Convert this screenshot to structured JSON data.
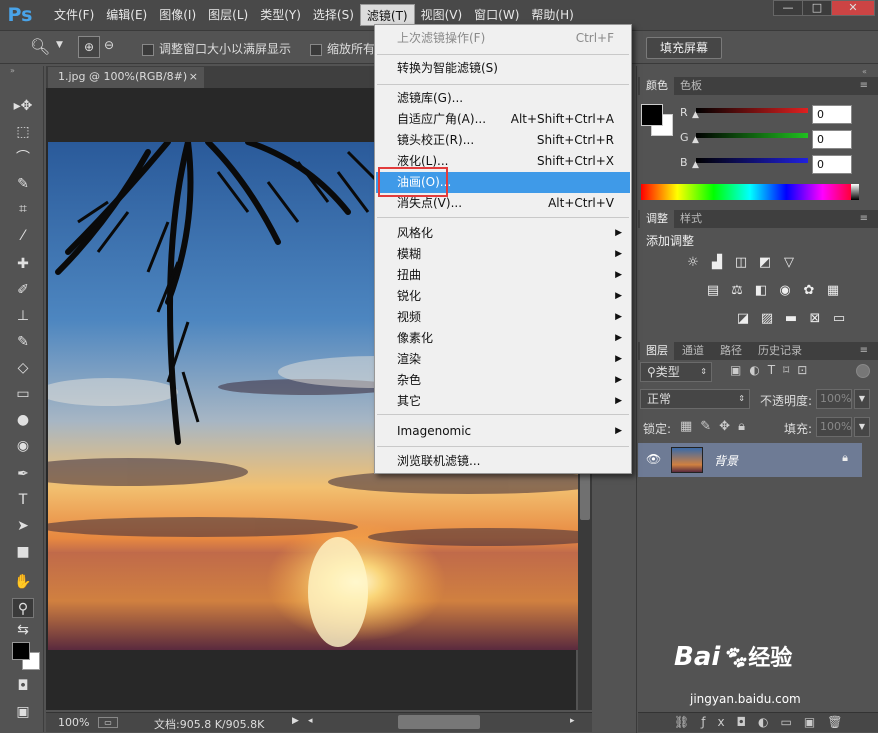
{
  "app": {
    "logo": "Ps"
  },
  "menubar": {
    "items": [
      "文件(F)",
      "编辑(E)",
      "图像(I)",
      "图层(L)",
      "类型(Y)",
      "选择(S)",
      "滤镜(T)",
      "视图(V)",
      "窗口(W)",
      "帮助(H)"
    ],
    "active": "滤镜(T)"
  },
  "window_controls": {
    "minimize": "—",
    "maximize": "□",
    "close": "✕"
  },
  "options": {
    "resize_label": "调整窗口大小以满屏显示",
    "zoom_all_label": "缩放所有",
    "fill_screen": "填充屏幕"
  },
  "document": {
    "tab_title": "1.jpg @ 100%(RGB/8#)",
    "tab_close": "×",
    "zoom": "100%",
    "doc_info": "文档:905.8 K/905.8K"
  },
  "filter_menu": {
    "last_filter": {
      "label": "上次滤镜操作(F)",
      "shortcut": "Ctrl+F"
    },
    "smart": {
      "label": "转换为智能滤镜(S)"
    },
    "gallery": {
      "label": "滤镜库(G)..."
    },
    "adaptive": {
      "label": "自适应广角(A)...",
      "shortcut": "Alt+Shift+Ctrl+A"
    },
    "lens": {
      "label": "镜头校正(R)...",
      "shortcut": "Shift+Ctrl+R"
    },
    "liquify": {
      "label": "液化(L)...",
      "shortcut": "Shift+Ctrl+X"
    },
    "oil": {
      "label": "油画(O)..."
    },
    "vanish": {
      "label": "消失点(V)...",
      "shortcut": "Alt+Ctrl+V"
    },
    "submenus": [
      "风格化",
      "模糊",
      "扭曲",
      "锐化",
      "视频",
      "像素化",
      "渲染",
      "杂色",
      "其它"
    ],
    "imagenomic": "Imagenomic",
    "browse": "浏览联机滤镜..."
  },
  "color_panel": {
    "tabs": [
      "颜色",
      "色板"
    ],
    "channels": [
      {
        "name": "R",
        "value": "0",
        "color": "#e02020"
      },
      {
        "name": "G",
        "value": "0",
        "color": "#20c020"
      },
      {
        "name": "B",
        "value": "0",
        "color": "#2020e0"
      }
    ]
  },
  "adjust_panel": {
    "tabs": [
      "调整",
      "样式"
    ],
    "title": "添加调整"
  },
  "layers_panel": {
    "tabs": [
      "图层",
      "通道",
      "路径",
      "历史记录"
    ],
    "kind": "类型",
    "blend": "正常",
    "opacity_label": "不透明度:",
    "opacity": "100%",
    "lock_label": "锁定:",
    "fill_label": "填充:",
    "fill": "100%",
    "layer_name": "背景"
  },
  "watermark": {
    "brand": "Bai",
    "brand2": "经验",
    "url": "jingyan.baidu.com"
  }
}
